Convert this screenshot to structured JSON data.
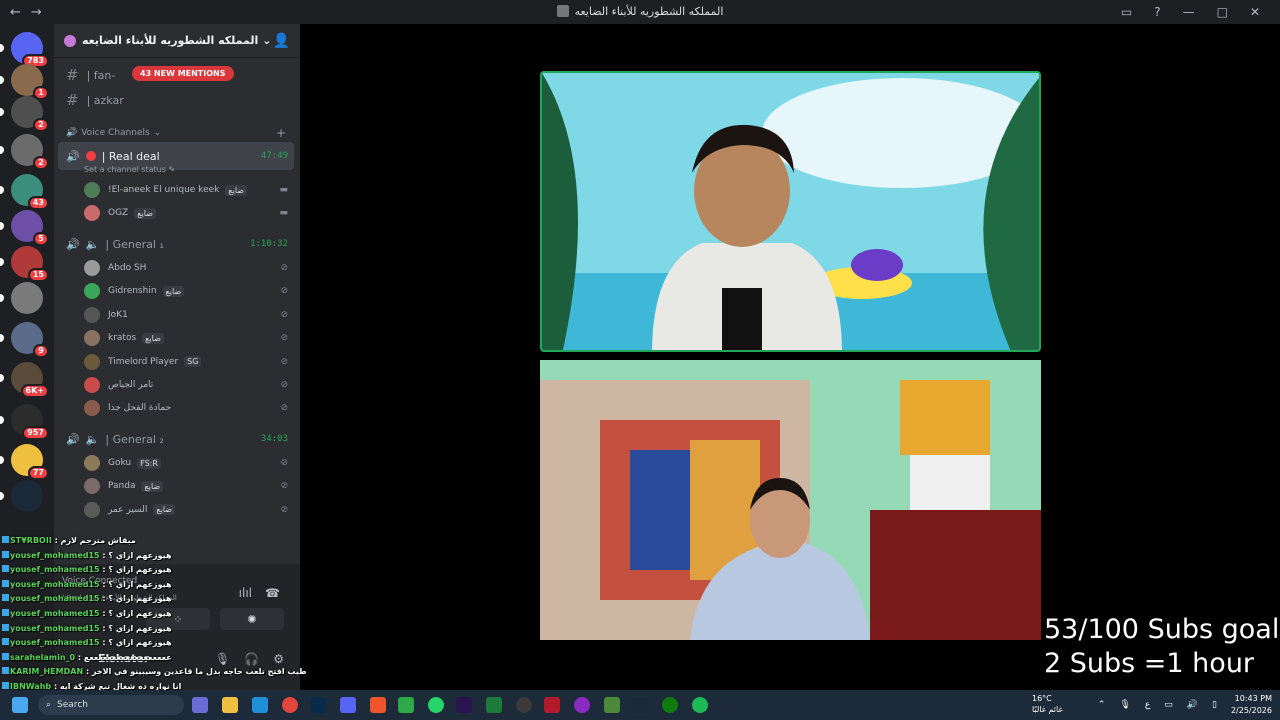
{
  "window": {
    "title": "المملكه الشطوريه للأبناء الضايعه"
  },
  "guilds": [
    {
      "badge": "783",
      "color": "#5865f2"
    },
    {
      "badge": "1",
      "color": "#8a6a4c"
    },
    {
      "badge": "2",
      "color": "#4f4f4f"
    },
    {
      "badge": "2",
      "color": "#6b6b6b"
    },
    {
      "badge": "43",
      "color": "#3b8e7d"
    },
    {
      "badge": "5",
      "color": "#6e4fa8"
    },
    {
      "badge": "15",
      "color": "#b03a3a"
    },
    {
      "badge": "",
      "color": "#7a7a7a"
    },
    {
      "badge": "9",
      "color": "#5b6b8a"
    },
    {
      "badge": "6K+",
      "color": "#5a4a3a"
    },
    {
      "badge": "957",
      "color": "#2c2c2c"
    },
    {
      "badge": "77",
      "color": "#f0c040"
    },
    {
      "badge": "",
      "color": "#1b2838"
    }
  ],
  "server": {
    "name": "المملكه الشطوريه للأبناء الضايعه"
  },
  "text_channels": [
    {
      "name": "| fan-",
      "mention": "43 NEW MENTIONS"
    },
    {
      "name": "| azkar"
    }
  ],
  "voice_category": "Voice Channels",
  "voice_channels": [
    {
      "name": "| Real deal",
      "timer": "47:49",
      "status": "Set a channel status",
      "members": [
        {
          "name": "!El-aneek El unique keek",
          "tag": "ضايع",
          "color": "#4e7d5a"
        },
        {
          "name": "OGZ",
          "tag": "ضايع",
          "color": "#c96a6a"
        }
      ]
    },
    {
      "name": "| General ₁",
      "timer": "1:10:32",
      "members": [
        {
          "name": "Abdo SH",
          "tag": "",
          "color": "#9a9a9a"
        },
        {
          "name": "Gidrenshin",
          "tag": "ضايع",
          "color": "#3ba55c"
        },
        {
          "name": "JoK1",
          "tag": "",
          "color": "#555"
        },
        {
          "name": "kratos",
          "tag": "ضايع",
          "color": "#8a7060"
        },
        {
          "name": "Timelord Player",
          "tag": "SG",
          "color": "#6a5a3a"
        },
        {
          "name": "تامر الجياص",
          "tag": "",
          "color": "#c94b4b"
        },
        {
          "name": "حمادة الفحل جدا",
          "tag": "",
          "color": "#8a5a4a"
        }
      ]
    },
    {
      "name": "| General ₂",
      "timer": "34:03",
      "members": [
        {
          "name": "Goku",
          "tag": "FS:R",
          "color": "#8a7a5a"
        },
        {
          "name": "Panda",
          "tag": "ضايع",
          "color": "#7a6a6a"
        },
        {
          "name": "السير عمر",
          "tag": "ضايع",
          "color": "#5a5a5a"
        }
      ]
    }
  ],
  "user_panel": {
    "voice_connected": "Voice Connected",
    "channel_path": "| Real deal / المملكه الشطوريه للأبناء",
    "username": "Elshater"
  },
  "chat_overlay": [
    {
      "name": "ST¥RBOII",
      "msg": ": مبقاش مترجم لازم"
    },
    {
      "name": "yousef_mohamed15",
      "msg": ": هيوزعهم ازاي ؟"
    },
    {
      "name": "yousef_mohamed15",
      "msg": ": هيوزعهم ازاي ؟"
    },
    {
      "name": "yousef_mohamed15",
      "msg": ": هيوزعهم ازاي ؟"
    },
    {
      "name": "yousef_mohamed15",
      "msg": ": هيوزعهم ازاي ؟"
    },
    {
      "name": "yousef_mohamed15",
      "msg": ": هيوزعهم ازاي ؟"
    },
    {
      "name": "yousef_mohamed15",
      "msg": ": هيوزعهم ازاي ؟"
    },
    {
      "name": "yousef_mohamed15",
      "msg": ": هيوزعهم ازاي ؟"
    },
    {
      "name": "sarahelamin_0",
      "msg": ": ععععععععععععععععععع"
    },
    {
      "name": "KARIM_HEMDAN",
      "msg": ": طيب افتح تلعب حاجه بدل ما قاعدين وسيبينو في الاخر"
    },
    {
      "name": "IBNWahb",
      "msg": ": انا نواره ده شغال تبع شركة ايه"
    }
  ],
  "overlay_text": {
    "line1": "53/100 Subs goal",
    "line2": "2 Subs =1 hour"
  },
  "taskbar": {
    "search_placeholder": "Search",
    "weather_temp": "16°C",
    "weather_desc": "غائم غالبًا",
    "lang": "ع",
    "time": "10:43 PM",
    "date": "2/25/2026"
  }
}
